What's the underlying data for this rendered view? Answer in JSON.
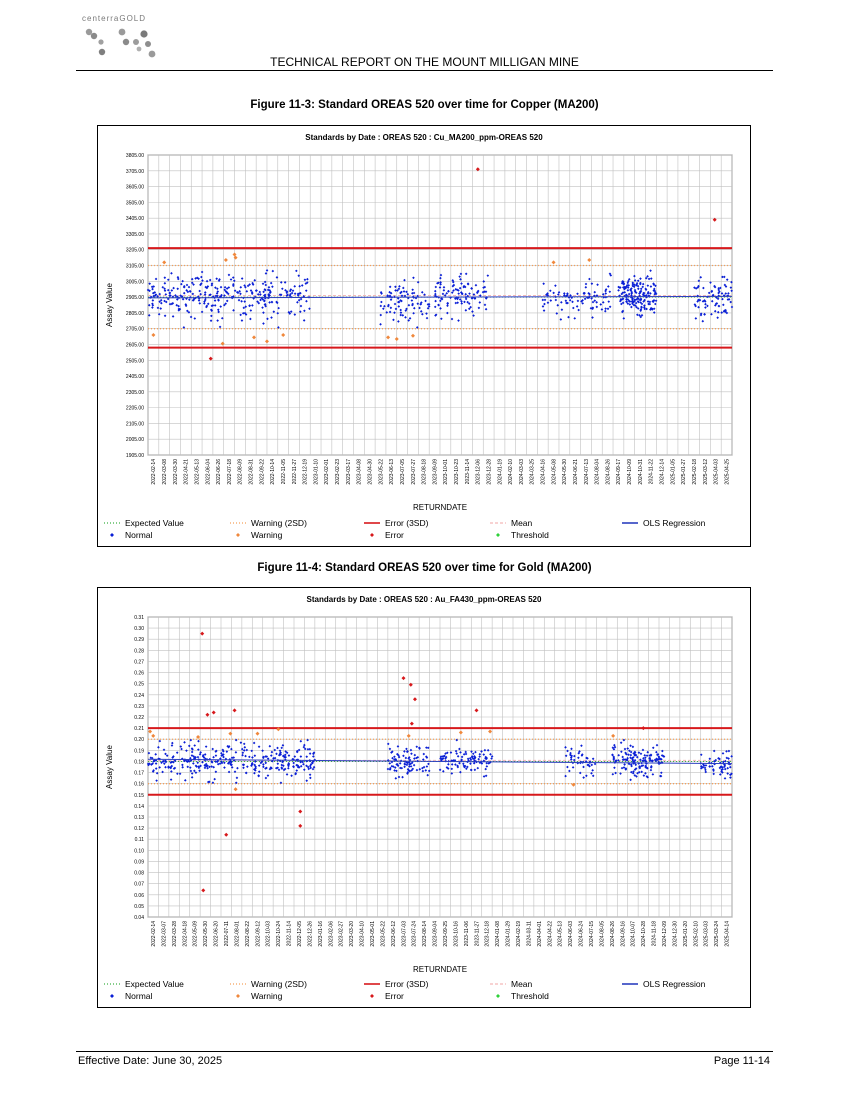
{
  "header": {
    "logo_text": "centerraGOLD",
    "report_title": "TECHNICAL REPORT ON THE MOUNT MILLIGAN MINE"
  },
  "footer": {
    "effective_date": "Effective Date: June 30, 2025",
    "page": "Page 11-14"
  },
  "figures": [
    {
      "caption": "Figure 11-3: Standard OREAS 520 over time for Copper (MA200)"
    },
    {
      "caption": "Figure 11-4: Standard OREAS 520 over time for Gold (MA200)"
    }
  ],
  "legend_items": [
    {
      "label": "Expected Value",
      "kind": "line",
      "style": "dotted",
      "color": "#3cb043"
    },
    {
      "label": "Warning (2SD)",
      "kind": "line",
      "style": "dotted",
      "color": "#f5a05a"
    },
    {
      "label": "Error (3SD)",
      "kind": "line",
      "style": "solid",
      "color": "#d7191c"
    },
    {
      "label": "Mean",
      "kind": "line",
      "style": "dashed",
      "color": "#f4b8b8"
    },
    {
      "label": "OLS Regression",
      "kind": "line",
      "style": "solid",
      "color": "#2b3fbf"
    },
    {
      "label": "Normal",
      "kind": "marker",
      "color": "#0a1fd6"
    },
    {
      "label": "Warning",
      "kind": "marker",
      "color": "#f0883c"
    },
    {
      "label": "Error",
      "kind": "marker",
      "color": "#d7191c"
    },
    {
      "label": "Threshold",
      "kind": "marker",
      "color": "#2fd13a"
    }
  ],
  "chart_data": [
    {
      "type": "scatter",
      "title": "Standards by Date : OREAS 520 : Cu_MA200_ppm-OREAS 520",
      "xlabel": "RETURNDATE",
      "ylabel": "Assay Value",
      "ylim": [
        1905,
        3805
      ],
      "yticks": [
        "1905.00",
        "2005.00",
        "2105.00",
        "2205.00",
        "2305.00",
        "2405.00",
        "2505.00",
        "2605.00",
        "2705.00",
        "2805.00",
        "2905.00",
        "3005.00",
        "3105.00",
        "3205.00",
        "3305.00",
        "3405.00",
        "3505.00",
        "3605.00",
        "3705.00",
        "3805.00"
      ],
      "xticks": [
        "2022-02-14",
        "2022-03-08",
        "2022-03-30",
        "2022-04-21",
        "2022-05-13",
        "2022-06-04",
        "2022-06-26",
        "2022-07-18",
        "2022-08-09",
        "2022-08-31",
        "2022-09-22",
        "2022-10-14",
        "2022-11-05",
        "2022-11-27",
        "2022-12-19",
        "2023-01-10",
        "2023-02-01",
        "2023-02-23",
        "2023-03-17",
        "2023-04-08",
        "2023-04-30",
        "2023-05-22",
        "2023-06-13",
        "2023-07-05",
        "2023-07-27",
        "2023-08-18",
        "2023-09-09",
        "2023-10-01",
        "2023-10-23",
        "2023-11-14",
        "2023-12-06",
        "2023-12-28",
        "2024-01-19",
        "2024-02-10",
        "2024-03-03",
        "2024-03-25",
        "2024-04-16",
        "2024-05-08",
        "2024-05-30",
        "2024-06-21",
        "2024-07-13",
        "2024-08-04",
        "2024-08-26",
        "2024-09-17",
        "2024-10-09",
        "2024-10-31",
        "2024-11-22",
        "2024-12-14",
        "2025-01-05",
        "2025-01-27",
        "2025-02-18",
        "2025-03-12",
        "2025-04-03",
        "2025-04-25"
      ],
      "grid": true,
      "reference_lines": {
        "expected": 2905,
        "warning": [
          2705,
          3105
        ],
        "error": [
          2585,
          3215
        ],
        "mean": 2915
      },
      "regression": {
        "start": 2900,
        "end": 2910
      },
      "clusters": [
        {
          "x_range": [
            0,
            15
          ],
          "center": 2905,
          "spread": 100,
          "count": 320
        },
        {
          "x_range": [
            21.5,
            26
          ],
          "center": 2870,
          "spread": 90,
          "count": 90
        },
        {
          "x_range": [
            26.5,
            31.5
          ],
          "center": 2920,
          "spread": 90,
          "count": 110
        },
        {
          "x_range": [
            36.5,
            43
          ],
          "center": 2900,
          "spread": 80,
          "count": 90
        },
        {
          "x_range": [
            43.5,
            47
          ],
          "center": 2920,
          "spread": 90,
          "count": 170
        },
        {
          "x_range": [
            50.5,
            54
          ],
          "center": 2890,
          "spread": 100,
          "count": 80
        }
      ],
      "outliers": [
        {
          "x": 1.5,
          "y": 3125,
          "kind": "warning"
        },
        {
          "x": 0.5,
          "y": 2665,
          "kind": "warning"
        },
        {
          "x": 5.8,
          "y": 2515,
          "kind": "error"
        },
        {
          "x": 6.9,
          "y": 2610,
          "kind": "warning"
        },
        {
          "x": 7.2,
          "y": 3140,
          "kind": "warning"
        },
        {
          "x": 8.0,
          "y": 3175,
          "kind": "warning"
        },
        {
          "x": 8.1,
          "y": 3155,
          "kind": "warning"
        },
        {
          "x": 9.8,
          "y": 2650,
          "kind": "warning"
        },
        {
          "x": 11.0,
          "y": 2625,
          "kind": "warning"
        },
        {
          "x": 12.5,
          "y": 2665,
          "kind": "warning"
        },
        {
          "x": 22.2,
          "y": 2650,
          "kind": "warning"
        },
        {
          "x": 23.0,
          "y": 2640,
          "kind": "warning"
        },
        {
          "x": 24.5,
          "y": 2660,
          "kind": "warning"
        },
        {
          "x": 30.5,
          "y": 3715,
          "kind": "error"
        },
        {
          "x": 37.5,
          "y": 3125,
          "kind": "warning"
        },
        {
          "x": 40.8,
          "y": 3140,
          "kind": "warning"
        },
        {
          "x": 52.4,
          "y": 3395,
          "kind": "error"
        }
      ]
    },
    {
      "type": "scatter",
      "title": "Standards by Date : OREAS 520 : Au_FA430_ppm-OREAS 520",
      "xlabel": "RETURNDATE",
      "ylabel": "Assay Value",
      "ylim": [
        0.04,
        0.31
      ],
      "yticks": [
        "0.04",
        "0.05",
        "0.06",
        "0.07",
        "0.08",
        "0.09",
        "0.10",
        "0.11",
        "0.12",
        "0.13",
        "0.14",
        "0.15",
        "0.16",
        "0.17",
        "0.18",
        "0.19",
        "0.20",
        "0.21",
        "0.22",
        "0.23",
        "0.24",
        "0.25",
        "0.26",
        "0.27",
        "0.28",
        "0.29",
        "0.30",
        "0.31"
      ],
      "xticks": [
        "2022-02-14",
        "2022-03-07",
        "2022-03-28",
        "2022-04-18",
        "2022-05-09",
        "2022-05-30",
        "2022-06-20",
        "2022-07-11",
        "2022-08-01",
        "2022-08-22",
        "2022-09-12",
        "2022-10-03",
        "2022-10-24",
        "2022-11-14",
        "2022-12-05",
        "2022-12-26",
        "2023-01-16",
        "2023-02-06",
        "2023-02-27",
        "2023-03-20",
        "2023-04-10",
        "2023-05-01",
        "2023-05-22",
        "2023-06-12",
        "2023-07-03",
        "2023-07-24",
        "2023-08-14",
        "2023-09-04",
        "2023-09-25",
        "2023-10-16",
        "2023-11-06",
        "2023-11-27",
        "2023-12-18",
        "2024-01-08",
        "2024-01-29",
        "2024-02-19",
        "2024-03-11",
        "2024-04-01",
        "2024-04-22",
        "2024-05-13",
        "2024-06-03",
        "2024-06-24",
        "2024-07-15",
        "2024-08-05",
        "2024-08-26",
        "2024-09-16",
        "2024-10-07",
        "2024-10-28",
        "2024-11-18",
        "2024-12-09",
        "2024-12-30",
        "2025-01-20",
        "2025-02-10",
        "2025-03-03",
        "2025-03-24",
        "2025-04-14"
      ],
      "grid": true,
      "reference_lines": {
        "expected": 0.18,
        "warning": [
          0.16,
          0.2
        ],
        "error": [
          0.15,
          0.21
        ],
        "mean": 0.181
      },
      "regression": {
        "start": 0.182,
        "end": 0.178
      },
      "clusters": [
        {
          "x_range": [
            0,
            16
          ],
          "center": 0.181,
          "spread": 0.011,
          "count": 340
        },
        {
          "x_range": [
            23,
            27
          ],
          "center": 0.18,
          "spread": 0.011,
          "count": 90
        },
        {
          "x_range": [
            28,
            33
          ],
          "center": 0.181,
          "spread": 0.01,
          "count": 100
        },
        {
          "x_range": [
            40,
            43
          ],
          "center": 0.18,
          "spread": 0.009,
          "count": 45
        },
        {
          "x_range": [
            44.5,
            49.5
          ],
          "center": 0.18,
          "spread": 0.009,
          "count": 150
        },
        {
          "x_range": [
            53,
            56
          ],
          "center": 0.178,
          "spread": 0.009,
          "count": 60
        }
      ],
      "outliers": [
        {
          "x": 0.2,
          "y": 0.207,
          "kind": "warning"
        },
        {
          "x": 0.5,
          "y": 0.203,
          "kind": "warning"
        },
        {
          "x": 4.8,
          "y": 0.202,
          "kind": "warning"
        },
        {
          "x": 5.2,
          "y": 0.295,
          "kind": "error"
        },
        {
          "x": 5.3,
          "y": 0.064,
          "kind": "error"
        },
        {
          "x": 5.7,
          "y": 0.222,
          "kind": "error"
        },
        {
          "x": 6.3,
          "y": 0.224,
          "kind": "error"
        },
        {
          "x": 7.5,
          "y": 0.114,
          "kind": "error"
        },
        {
          "x": 7.9,
          "y": 0.205,
          "kind": "warning"
        },
        {
          "x": 8.3,
          "y": 0.226,
          "kind": "error"
        },
        {
          "x": 8.4,
          "y": 0.155,
          "kind": "warning"
        },
        {
          "x": 10.5,
          "y": 0.205,
          "kind": "warning"
        },
        {
          "x": 12.5,
          "y": 0.209,
          "kind": "warning"
        },
        {
          "x": 14.6,
          "y": 0.135,
          "kind": "error"
        },
        {
          "x": 14.6,
          "y": 0.122,
          "kind": "error"
        },
        {
          "x": 24.5,
          "y": 0.255,
          "kind": "error"
        },
        {
          "x": 25.2,
          "y": 0.249,
          "kind": "error"
        },
        {
          "x": 25.6,
          "y": 0.236,
          "kind": "error"
        },
        {
          "x": 25.3,
          "y": 0.214,
          "kind": "error"
        },
        {
          "x": 25.0,
          "y": 0.203,
          "kind": "warning"
        },
        {
          "x": 30.0,
          "y": 0.206,
          "kind": "warning"
        },
        {
          "x": 31.5,
          "y": 0.226,
          "kind": "error"
        },
        {
          "x": 32.8,
          "y": 0.207,
          "kind": "warning"
        },
        {
          "x": 40.8,
          "y": 0.159,
          "kind": "warning"
        },
        {
          "x": 44.6,
          "y": 0.203,
          "kind": "warning"
        },
        {
          "x": 47.5,
          "y": 0.21,
          "kind": "error"
        }
      ]
    }
  ]
}
